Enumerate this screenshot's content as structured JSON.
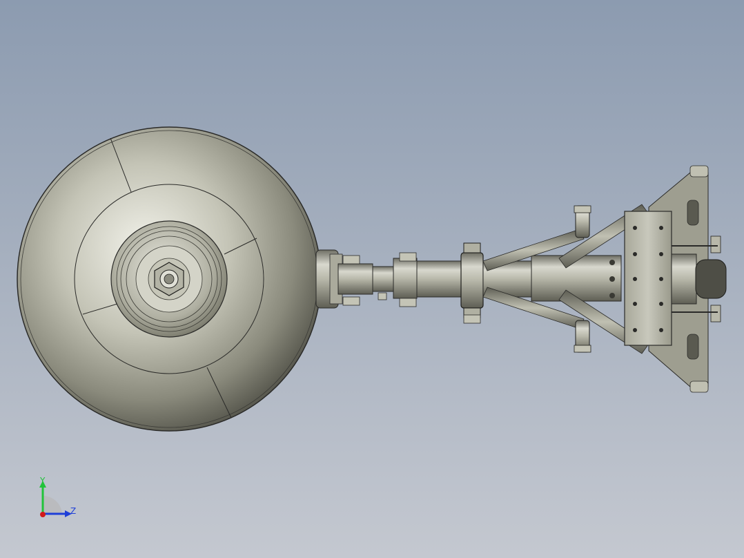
{
  "viewport": {
    "background_top": "#8c9bb0",
    "background_bottom": "#c4c8d0",
    "part_color": "#9c9c8e",
    "edge_color": "#2a2a28"
  },
  "triad": {
    "y_label": "Y",
    "z_label": "Z",
    "y_color": "#22c33a",
    "z_color": "#1e3fd8",
    "x_color": "#d11a1a"
  }
}
